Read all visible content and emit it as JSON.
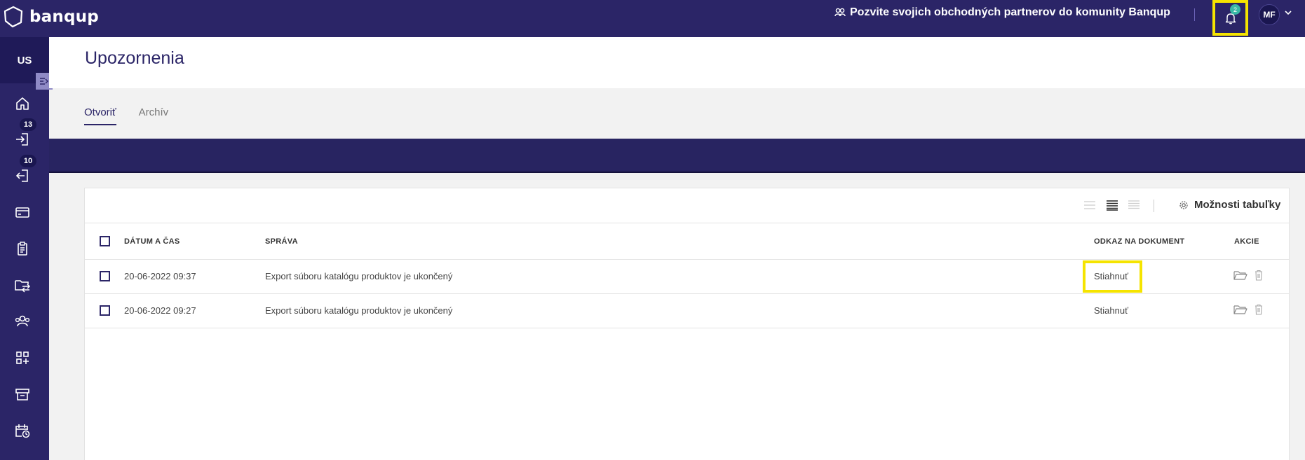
{
  "app": {
    "brand": "banqup",
    "invite_text": "Pozvite svojich obchodných partnerov do komunity Banqup",
    "notifications_count": "2",
    "user_initials": "MF",
    "org_initials": "US"
  },
  "sidebar": {
    "items": [
      {
        "icon": "home-icon",
        "badge": ""
      },
      {
        "icon": "inbox-icon",
        "badge": "13"
      },
      {
        "icon": "outbox-icon",
        "badge": "10"
      },
      {
        "icon": "payment-card-icon",
        "badge": ""
      },
      {
        "icon": "clipboard-icon",
        "badge": ""
      },
      {
        "icon": "transfer-folder-icon",
        "badge": ""
      },
      {
        "icon": "contacts-icon",
        "badge": ""
      },
      {
        "icon": "apps-add-icon",
        "badge": ""
      },
      {
        "icon": "archive-icon",
        "badge": ""
      },
      {
        "icon": "calendar-clock-icon",
        "badge": ""
      }
    ]
  },
  "page": {
    "title": "Upozornenia",
    "tabs": [
      {
        "label": "Otvoriť",
        "active": true
      },
      {
        "label": "Archív",
        "active": false
      }
    ]
  },
  "table": {
    "options_label": "Možnosti tabuľky",
    "columns": {
      "datetime": "DÁTUM A ČAS",
      "message": "SPRÁVA",
      "link": "ODKAZ NA DOKUMENT",
      "actions": "AKCIE"
    },
    "rows": [
      {
        "datetime": "20-06-2022 09:37",
        "message": "Export súboru katalógu produktov je ukončený",
        "link": "Stiahnuť",
        "highlighted": true
      },
      {
        "datetime": "20-06-2022 09:27",
        "message": "Export súboru katalógu produktov je ukončený",
        "link": "Stiahnuť",
        "highlighted": false
      }
    ]
  },
  "colors": {
    "primary": "#2b2567",
    "highlight": "#f5e400",
    "badge_teal": "#39b8a6"
  }
}
